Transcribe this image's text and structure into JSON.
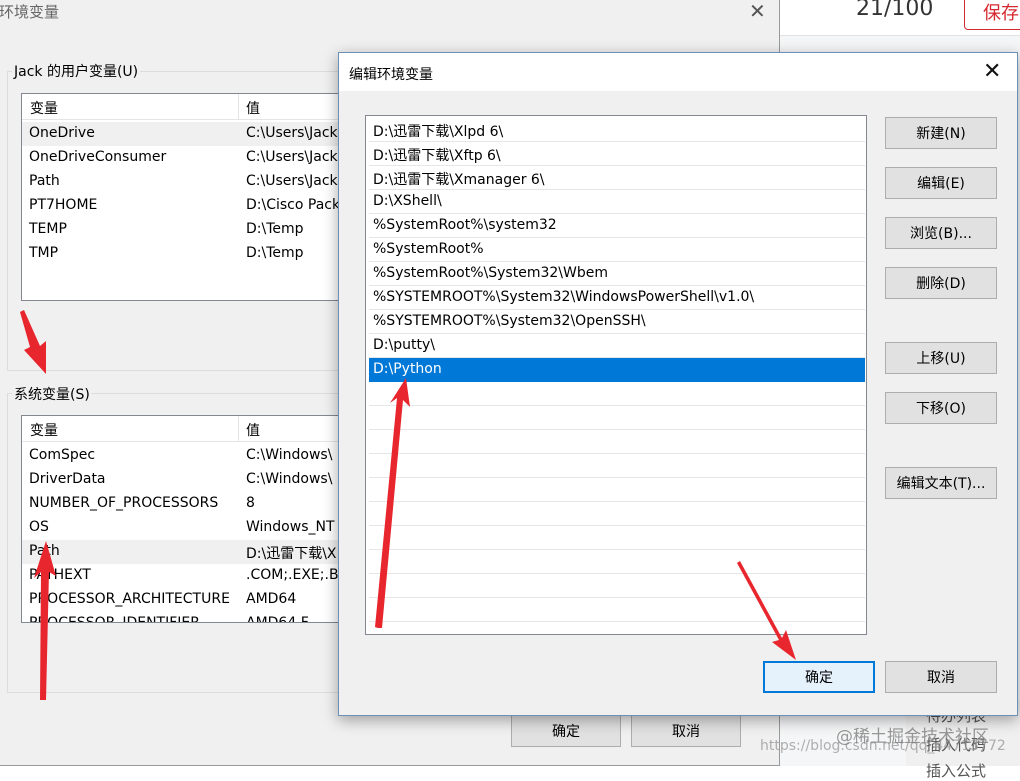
{
  "background_editor": {
    "counter": "21/100",
    "save_label": "保存",
    "sidebar_items": [
      "待办列表",
      "插入代码",
      "插入公式"
    ],
    "watermark_url": "https://blog.csdn.net/qq_44713772",
    "watermark_brand": "@稀土掘金技术社区"
  },
  "env_dialog": {
    "title": "环境变量",
    "close_glyph": "✕",
    "user_group_label": "Jack 的用户变量(U)",
    "system_group_label": "系统变量(S)",
    "col_var": "变量",
    "col_val": "值",
    "user_vars": [
      {
        "name": "OneDrive",
        "value": "C:\\Users\\Jack"
      },
      {
        "name": "OneDriveConsumer",
        "value": "C:\\Users\\Jack"
      },
      {
        "name": "Path",
        "value": "C:\\Users\\Jack"
      },
      {
        "name": "PT7HOME",
        "value": "D:\\Cisco Pack"
      },
      {
        "name": "TEMP",
        "value": "D:\\Temp"
      },
      {
        "name": "TMP",
        "value": "D:\\Temp"
      }
    ],
    "system_vars": [
      {
        "name": "ComSpec",
        "value": "C:\\Windows\\"
      },
      {
        "name": "DriverData",
        "value": "C:\\Windows\\"
      },
      {
        "name": "NUMBER_OF_PROCESSORS",
        "value": "8"
      },
      {
        "name": "OS",
        "value": "Windows_NT"
      },
      {
        "name": "Path",
        "value": "D:\\迅雷下载\\X"
      },
      {
        "name": "PATHEXT",
        "value": ".COM;.EXE;.B"
      },
      {
        "name": "PROCESSOR_ARCHITECTURE",
        "value": "AMD64"
      },
      {
        "name": "PROCESSOR_IDENTIFIER",
        "value": "AMD64 F"
      }
    ],
    "ok_label": "确定",
    "cancel_label": "取消"
  },
  "edit_dialog": {
    "title": "编辑环境变量",
    "close_glyph": "✕",
    "paths": [
      "D:\\迅雷下载\\Xlpd 6\\",
      "D:\\迅雷下载\\Xftp 6\\",
      "D:\\迅雷下载\\Xmanager 6\\",
      "D:\\XShell\\",
      "%SystemRoot%\\system32",
      "%SystemRoot%",
      "%SystemRoot%\\System32\\Wbem",
      "%SYSTEMROOT%\\System32\\WindowsPowerShell\\v1.0\\",
      "%SYSTEMROOT%\\System32\\OpenSSH\\",
      "D:\\putty\\",
      "D:\\Python"
    ],
    "selected_index": 10,
    "buttons": {
      "new": "新建(N)",
      "edit": "编辑(E)",
      "browse": "浏览(B)...",
      "delete": "删除(D)",
      "move_up": "上移(U)",
      "move_down": "下移(O)",
      "edit_text": "编辑文本(T)...",
      "ok": "确定",
      "cancel": "取消"
    }
  },
  "colors": {
    "selection": "#0078d7",
    "arrow": "#e8262e",
    "dialog_bg": "#f0f0f0"
  }
}
